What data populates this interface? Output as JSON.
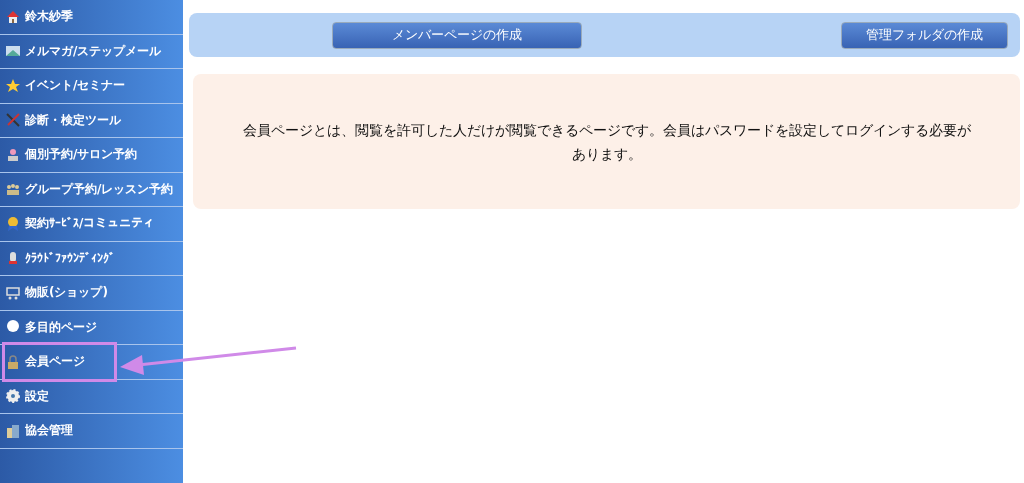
{
  "sidebar": {
    "items": [
      {
        "label": "鈴木紗季",
        "highlighted": false
      },
      {
        "label": "メルマガ/ステップメール",
        "highlighted": false
      },
      {
        "label": "イベント/セミナー",
        "highlighted": false
      },
      {
        "label": "診断・検定ツール",
        "highlighted": false
      },
      {
        "label": "個別予約/サロン予約",
        "highlighted": false
      },
      {
        "label": "グループ予約/レッスン予約",
        "highlighted": false
      },
      {
        "label": "契約ｻｰﾋﾞｽ/コミュニティ",
        "highlighted": false
      },
      {
        "label": "ｸﾗｳﾄﾞﾌｧｳﾝﾃﾞｨﾝｸﾞ",
        "highlighted": false
      },
      {
        "label": "物販(ショップ)",
        "highlighted": false
      },
      {
        "label": "多目的ページ",
        "highlighted": false
      },
      {
        "label": "会員ページ",
        "highlighted": true
      },
      {
        "label": "設定",
        "highlighted": false
      },
      {
        "label": "協会管理",
        "highlighted": false
      }
    ]
  },
  "toolbar": {
    "buttons": [
      "メンバーページの作成",
      "管理フォルダの作成"
    ]
  },
  "info": {
    "text": "会員ページとは、閲覧を許可した人だけが閲覧できるページです。会員はパスワードを設定してログインする必要があります。"
  }
}
